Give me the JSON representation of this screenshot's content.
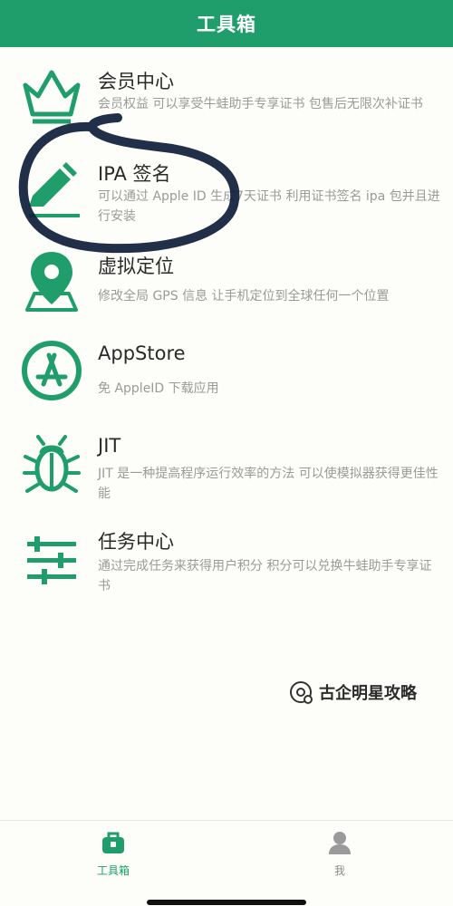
{
  "header": {
    "title": "工具箱"
  },
  "items": [
    {
      "title": "会员中心",
      "desc": "会员权益 可以享受牛蛙助手专享证书 包售后无限次补证书",
      "icon": "crown-icon"
    },
    {
      "title": "IPA 签名",
      "desc": "可以通过 Apple ID 生成7天证书 利用证书签名 ipa 包并且进行安装",
      "icon": "pencil-icon"
    },
    {
      "title": "虚拟定位",
      "desc": "修改全局 GPS 信息 让手机定位到全球任何一个位置",
      "icon": "map-pin-icon"
    },
    {
      "title": "AppStore",
      "desc": "免 AppleID 下载应用",
      "icon": "appstore-icon"
    },
    {
      "title": "JIT",
      "desc": "JIT 是一种提高程序运行效率的方法 可以使模拟器获得更佳性能",
      "icon": "bug-icon"
    },
    {
      "title": "任务中心",
      "desc": "通过完成任务来获得用户积分 积分可以兑换牛蛙助手专享证书",
      "icon": "sliders-icon"
    }
  ],
  "watermark": {
    "text": "古企明星攻略"
  },
  "tabbar": {
    "tabs": [
      {
        "label": "工具箱",
        "icon": "toolbox-icon",
        "active": true
      },
      {
        "label": "我",
        "icon": "user-icon",
        "active": false
      }
    ]
  },
  "colors": {
    "accent": "#1f9d6a",
    "text": "#2a2a2a",
    "muted": "#9a9a9a",
    "inactive": "#8a8a8a",
    "scribble": "#0f1d3a"
  }
}
